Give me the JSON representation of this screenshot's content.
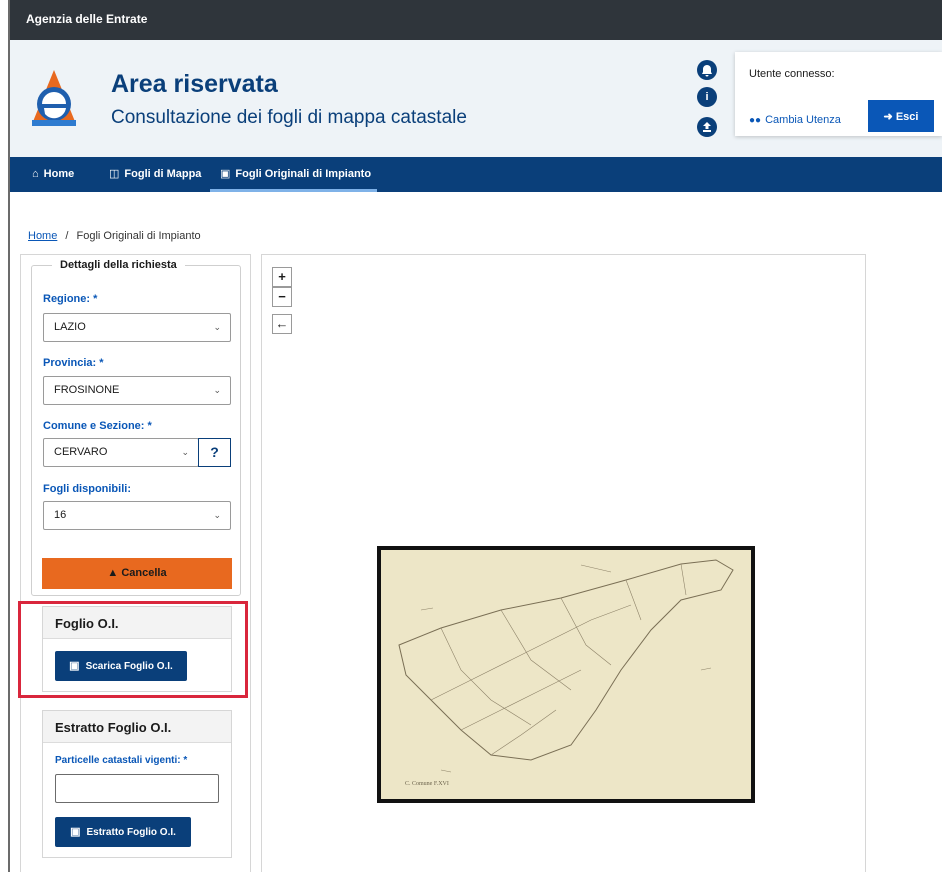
{
  "topbar": {
    "brand": "Agenzia delle Entrate"
  },
  "header": {
    "title": "Area riservata",
    "subtitle": "Consultazione dei fogli di mappa catastale",
    "icons": [
      "bell-icon",
      "info-icon",
      "upload-icon"
    ],
    "user_label": "Utente connesso:",
    "switch_user_label": "Cambia Utenza",
    "logout_label": "Esci"
  },
  "nav": {
    "items": [
      {
        "label": "Home",
        "icon": "home-icon"
      },
      {
        "label": "Fogli di Mappa",
        "icon": "columns-icon"
      },
      {
        "label": "Fogli Originali di Impianto",
        "icon": "image-icon",
        "active": true
      }
    ]
  },
  "breadcrumb": {
    "home": "Home",
    "separator": "/",
    "current": "Fogli Originali di Impianto"
  },
  "request": {
    "legend": "Dettagli della richiesta",
    "region_label": "Regione: *",
    "region_value": "LAZIO",
    "province_label": "Provincia: *",
    "province_value": "FROSINONE",
    "comune_label": "Comune e Sezione: *",
    "comune_value": "CERVARO",
    "help_label": "?",
    "fogli_label": "Fogli disponibili:",
    "fogli_value": "16",
    "cancel_label": "Cancella"
  },
  "foglio_card": {
    "title": "Foglio O.I.",
    "button_label": "Scarica Foglio O.I."
  },
  "estratto_card": {
    "title": "Estratto Foglio O.I.",
    "particelle_label": "Particelle catastali vigenti: *",
    "particelle_value": "",
    "button_label": "Estratto Foglio O.I."
  },
  "map": {
    "zoom_in": "+",
    "zoom_out": "−",
    "back": "←",
    "sheet_caption": "C. Comune F.XVI"
  },
  "colors": {
    "brand_dark": "#0a3f7a",
    "link_blue": "#0a57b7",
    "cancel_orange": "#e8691f",
    "highlight_red": "#d9263c"
  }
}
